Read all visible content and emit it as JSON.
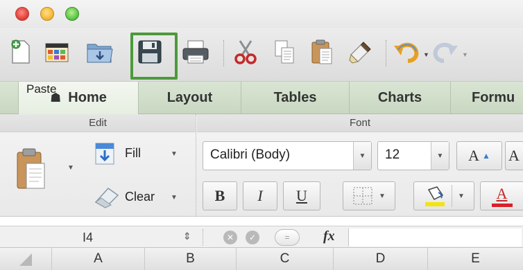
{
  "window": {
    "traffic_lights": [
      "close",
      "minimize",
      "zoom"
    ]
  },
  "toolbar": {
    "icons": [
      "new-document-icon",
      "templates-icon",
      "open-icon",
      "save-icon",
      "print-icon",
      "cut-icon",
      "copy-icon",
      "paste-icon",
      "format-painter-icon",
      "undo-icon",
      "redo-icon"
    ],
    "highlighted": "save-icon",
    "highlight_color": "#4c9a3a"
  },
  "tabs": [
    {
      "label": "Home",
      "active": true
    },
    {
      "label": "Layout",
      "active": false
    },
    {
      "label": "Tables",
      "active": false
    },
    {
      "label": "Charts",
      "active": false
    },
    {
      "label": "Formu",
      "active": false
    }
  ],
  "ribbon": {
    "edit_group": {
      "title": "Edit",
      "paste_label": "Paste",
      "fill_label": "Fill",
      "clear_label": "Clear"
    },
    "font_group": {
      "title": "Font",
      "font_name": "Calibri (Body)",
      "font_size": "12",
      "grow_font": "A",
      "shrink_font": "A",
      "bold": "B",
      "italic": "I",
      "underline": "U",
      "font_color_letter": "A",
      "highlight_color": "#f2e40d",
      "font_color": "#d8202a"
    }
  },
  "formula_bar": {
    "cell_reference": "I4",
    "fx_label": "fx",
    "formula": ""
  },
  "columns": [
    "A",
    "B",
    "C",
    "D",
    "E"
  ]
}
